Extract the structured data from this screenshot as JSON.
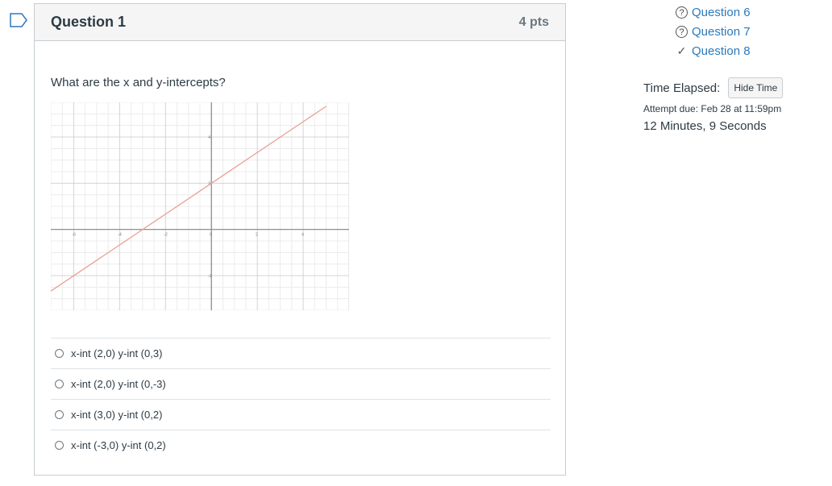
{
  "question": {
    "title": "Question 1",
    "points": "4 pts",
    "text": "What are the x and y-intercepts?",
    "answers": [
      "x-int (2,0) y-int (0,3)",
      "x-int (2,0) y-int (0,-3)",
      "x-int (3,0) y-int (0,2)",
      "x-int (-3,0) y-int (0,2)"
    ]
  },
  "nav": {
    "links": [
      {
        "label": "Question 6",
        "status": "unanswered"
      },
      {
        "label": "Question 7",
        "status": "unanswered"
      },
      {
        "label": "Question 8",
        "status": "answered"
      }
    ]
  },
  "timer": {
    "label": "Time Elapsed:",
    "hide_button": "Hide Time",
    "due": "Attempt due: Feb 28 at 11:59pm",
    "elapsed": "12 Minutes, 9 Seconds"
  },
  "chart_data": {
    "type": "line",
    "title": "",
    "x_ticks": [
      "-6",
      "-4",
      "-2",
      "0",
      "2",
      "4"
    ],
    "y_ticks": [
      "4",
      "2",
      "-2"
    ],
    "xlim": [
      -7,
      6
    ],
    "ylim": [
      -3.5,
      5.5
    ],
    "series": [
      {
        "x": [
          -7,
          5
        ],
        "y": [
          -2.67,
          5.33
        ],
        "color": "#e8a09a"
      }
    ],
    "grid": true
  }
}
